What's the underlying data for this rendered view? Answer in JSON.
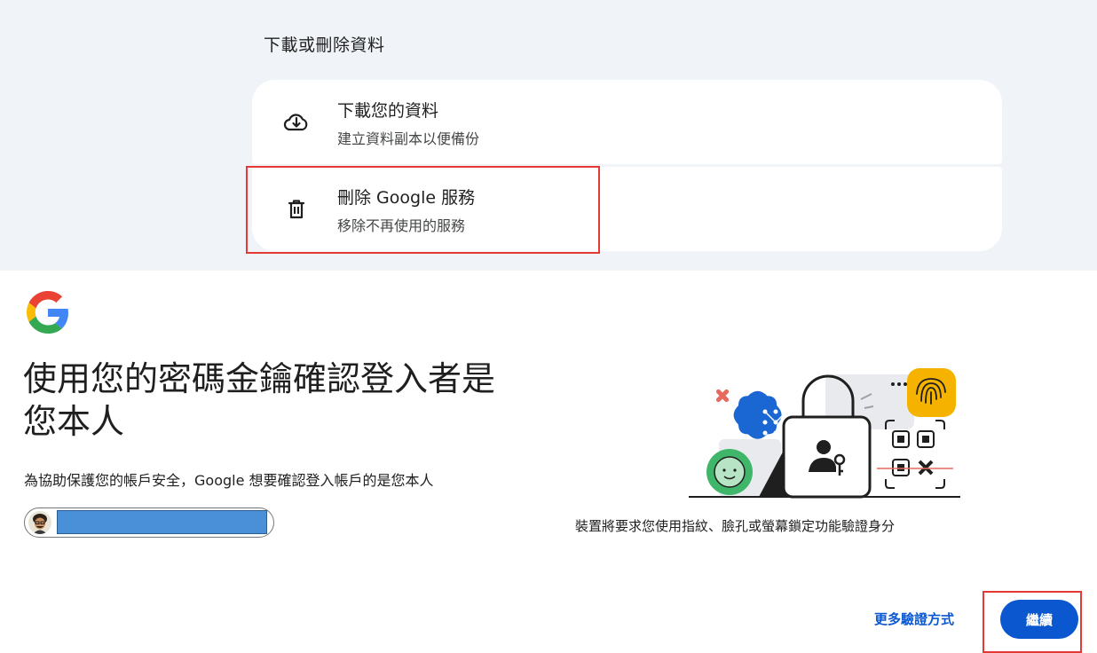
{
  "data_section": {
    "title": "下載或刪除資料",
    "options": [
      {
        "title": "下載您的資料",
        "subtitle": "建立資料副本以便備份",
        "icon": "cloud-download-icon"
      },
      {
        "title": "刪除 Google 服務",
        "subtitle": "移除不再使用的服務",
        "icon": "trash-icon"
      }
    ]
  },
  "verify": {
    "logo": "google-logo",
    "heading": "使用您的密碼金鑰確認登入者是您本人",
    "description": "為協助保護您的帳戶安全，Google 想要確認登入帳戶的是您本人",
    "illustration_caption": "裝置將要求您使用指紋、臉孔或螢幕鎖定功能驗證身分",
    "more_options_label": "更多驗證方式",
    "continue_label": "繼續"
  },
  "colors": {
    "panel_bg": "#f0f4f9",
    "primary": "#0b57d0",
    "highlight": "#e53935",
    "redaction": "#4a90d9"
  }
}
